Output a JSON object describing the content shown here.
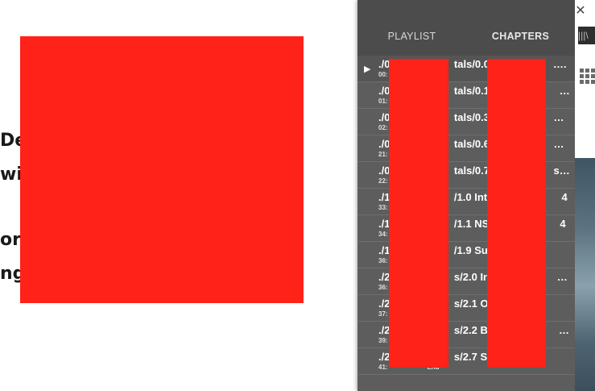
{
  "background_text": {
    "line1": "De",
    "line2": "wit",
    "line3": "ors",
    "line4": "ng"
  },
  "playlist": {
    "tabs": [
      {
        "label": "PLAYLIST",
        "active": false
      },
      {
        "label": "CHAPTERS",
        "active": true
      }
    ],
    "items": [
      {
        "title": "./0                      tals/0.0                      .mp4",
        "time": "00:",
        "current": true
      },
      {
        "title": "./0                      tals/0.10                      np4",
        "time": "01:",
        "current": false
      },
      {
        "title": "./0                      tals/0.3                      de...",
        "time": "02:",
        "current": false
      },
      {
        "title": "./0                      tals/0.6                      hav...",
        "time": "21:",
        "current": false
      },
      {
        "title": "./0                      tals/0.7                      s an...",
        "time": "22:",
        "current": false
      },
      {
        "title": "./1                      /1.0 Intro                      4",
        "time": "33:",
        "current": false
      },
      {
        "title": "./1                      /1.1 NSE                      4",
        "time": "34:",
        "current": false
      },
      {
        "title": "./1                      /1.9 Sum",
        "time": "36:",
        "current": false
      },
      {
        "title": "./2                      s/2.0 Int                      np4",
        "time": "36:",
        "current": false
      },
      {
        "title": "./2                      s/2.1 Ove",
        "time": "37:",
        "current": false
      },
      {
        "title": "./2                      s/2.2 Bre                      pes....",
        "time": "39:",
        "current": false
      },
      {
        "title": "./2                      s/2.7 Su",
        "time": "41:                      End",
        "current": false
      }
    ]
  },
  "window": {
    "close_glyph": "✕",
    "library_glyph": "|||\\"
  },
  "colors": {
    "redaction": "#ff2218",
    "panel": "#5d5d5d",
    "tab_bar": "#4c4c4c"
  }
}
